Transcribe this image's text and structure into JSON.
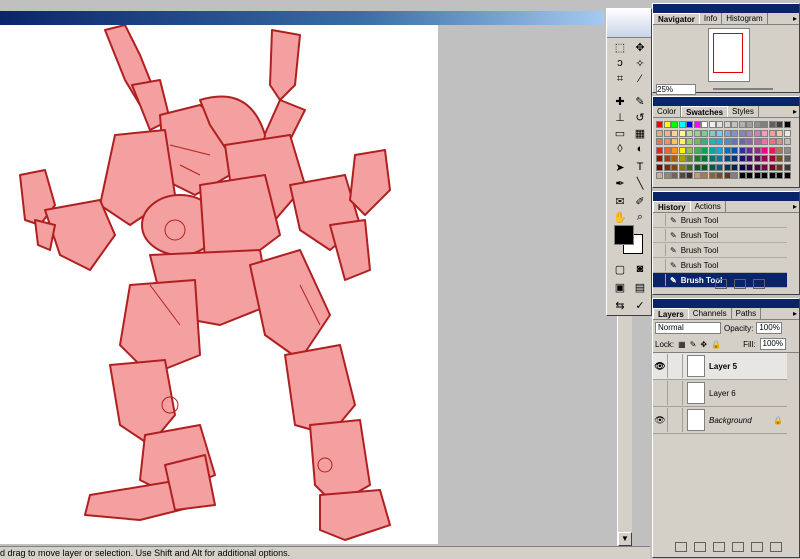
{
  "status_bar": {
    "text": "d drag to move layer or selection.  Use Shift and Alt for additional options."
  },
  "navigator_panel": {
    "tabs": [
      "Navigator",
      "Info",
      "Histogram"
    ],
    "zoom": "25%"
  },
  "color_panel": {
    "tabs": [
      "Color",
      "Swatches",
      "Styles"
    ],
    "swatch_rows": [
      [
        "#ff0000",
        "#ffff00",
        "#00ff00",
        "#00ffff",
        "#0000ff",
        "#ff00ff",
        "#ffffff",
        "#f0f0f0",
        "#e0e0e0",
        "#d0d0d0",
        "#c0c0c0",
        "#b0b0b0",
        "#a0a0a0",
        "#909090",
        "#808080",
        "#606060",
        "#404040",
        "#000000"
      ],
      [
        "#f5a08c",
        "#f7b38c",
        "#fdd58b",
        "#fff78f",
        "#c1dc8e",
        "#9dd08f",
        "#7ec8a0",
        "#7cccc8",
        "#6fcff6",
        "#7ba7d9",
        "#8493c9",
        "#8c83bd",
        "#a785bd",
        "#c483bc",
        "#f39bc1",
        "#f49c9c",
        "#eec4b0",
        "#e6e6e6"
      ],
      [
        "#ef6f58",
        "#f38f58",
        "#fbc358",
        "#fff45f",
        "#a3cd5f",
        "#6bbd66",
        "#3db07e",
        "#1cb8b1",
        "#00b6ef",
        "#4c8ecb",
        "#5f77b9",
        "#6a64ad",
        "#8e64ad",
        "#b864ab",
        "#ee70a6",
        "#ef6f80",
        "#c89a84",
        "#bdbdbd"
      ],
      [
        "#ed1c24",
        "#f26522",
        "#f7941d",
        "#fff200",
        "#8dc63f",
        "#39b54a",
        "#00a651",
        "#00a99d",
        "#00aeef",
        "#0072bc",
        "#0054a6",
        "#2e3192",
        "#662d91",
        "#92278f",
        "#ec008c",
        "#ed145b",
        "#a67c52",
        "#8c8c8c"
      ],
      [
        "#9e0b0f",
        "#a0410d",
        "#a36209",
        "#aba000",
        "#598527",
        "#197b30",
        "#007236",
        "#00746b",
        "#0076a3",
        "#004a80",
        "#003471",
        "#1b1464",
        "#440e62",
        "#630460",
        "#9e005d",
        "#9e0039",
        "#754c24",
        "#5a5a5a"
      ],
      [
        "#790000",
        "#7b2e00",
        "#7d4900",
        "#827b00",
        "#406618",
        "#005e20",
        "#005826",
        "#005952",
        "#005b7f",
        "#003663",
        "#002157",
        "#0d004c",
        "#32004b",
        "#4b0049",
        "#7b0046",
        "#7a0026",
        "#603913",
        "#3a3a3a"
      ],
      [
        "#c7b299",
        "#998675",
        "#736357",
        "#534741",
        "#37302a",
        "#c69c6d",
        "#a67c52",
        "#8c6239",
        "#754c24",
        "#603913",
        "#808080",
        "#000000",
        "#000000",
        "#000000",
        "#000000",
        "#000000",
        "#000000",
        "#000000"
      ]
    ]
  },
  "history_panel": {
    "tabs": [
      "History",
      "Actions"
    ],
    "items": [
      {
        "label": "Brush Tool",
        "selected": false
      },
      {
        "label": "Brush Tool",
        "selected": false
      },
      {
        "label": "Brush Tool",
        "selected": false
      },
      {
        "label": "Brush Tool",
        "selected": false
      },
      {
        "label": "Brush Tool",
        "selected": true
      }
    ]
  },
  "layers_panel": {
    "tabs": [
      "Layers",
      "Channels",
      "Paths"
    ],
    "blend_mode": "Normal",
    "opacity_label": "Opacity:",
    "opacity_value": "100%",
    "lock_label": "Lock:",
    "fill_label": "Fill:",
    "fill_value": "100%",
    "layers": [
      {
        "name": "Layer 5",
        "visible": true,
        "selected": true,
        "italic": false
      },
      {
        "name": "Layer 6",
        "visible": false,
        "selected": false,
        "italic": false
      },
      {
        "name": "Background",
        "visible": true,
        "selected": false,
        "italic": true
      }
    ]
  },
  "toolbox": {
    "foreground_color": "#000000",
    "background_color": "#ffffff"
  }
}
